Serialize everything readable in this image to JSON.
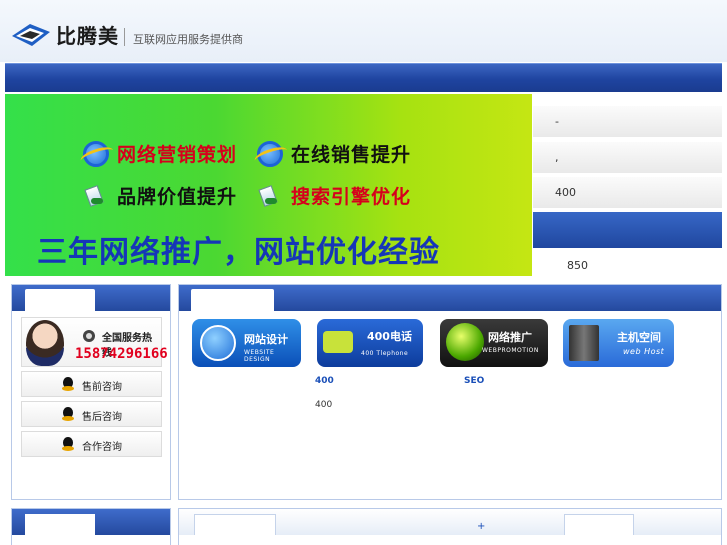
{
  "header": {
    "logo_text": "比腾美",
    "tagline": "互联网应用服务提供商"
  },
  "banner": {
    "services": [
      "网络营销策划",
      "在线销售提升",
      "品牌价值提升",
      "搜索引擎优化"
    ],
    "slogan": "三年网络推广，网站优化经验",
    "colors": {
      "accent_red": "#d6001c",
      "slogan_blue": "#1536b8"
    }
  },
  "right_panel": {
    "items": [
      "-",
      ",",
      "400",
      "",
      "850"
    ]
  },
  "contact": {
    "hotline_label": "全国服务热线",
    "hotline_number": "15874296166",
    "buttons": [
      "售前咨询",
      "售后咨询",
      "合作咨询"
    ]
  },
  "services": {
    "cards": [
      {
        "title": "网站设计",
        "subtitle": "WEBSITE DESIGN",
        "icon": "ie-logo-icon"
      },
      {
        "title": "400电话",
        "subtitle": "400 Tlephone",
        "icon": "phone-icon"
      },
      {
        "title": "网络推广",
        "subtitle": "WEBPROMOTION",
        "icon": "globe-icon"
      },
      {
        "title": "主机空间",
        "subtitle": "web Host",
        "icon": "server-icon"
      }
    ],
    "links": [
      "400",
      "SEO"
    ],
    "text": "400"
  },
  "bottom": {
    "plus": "+"
  }
}
